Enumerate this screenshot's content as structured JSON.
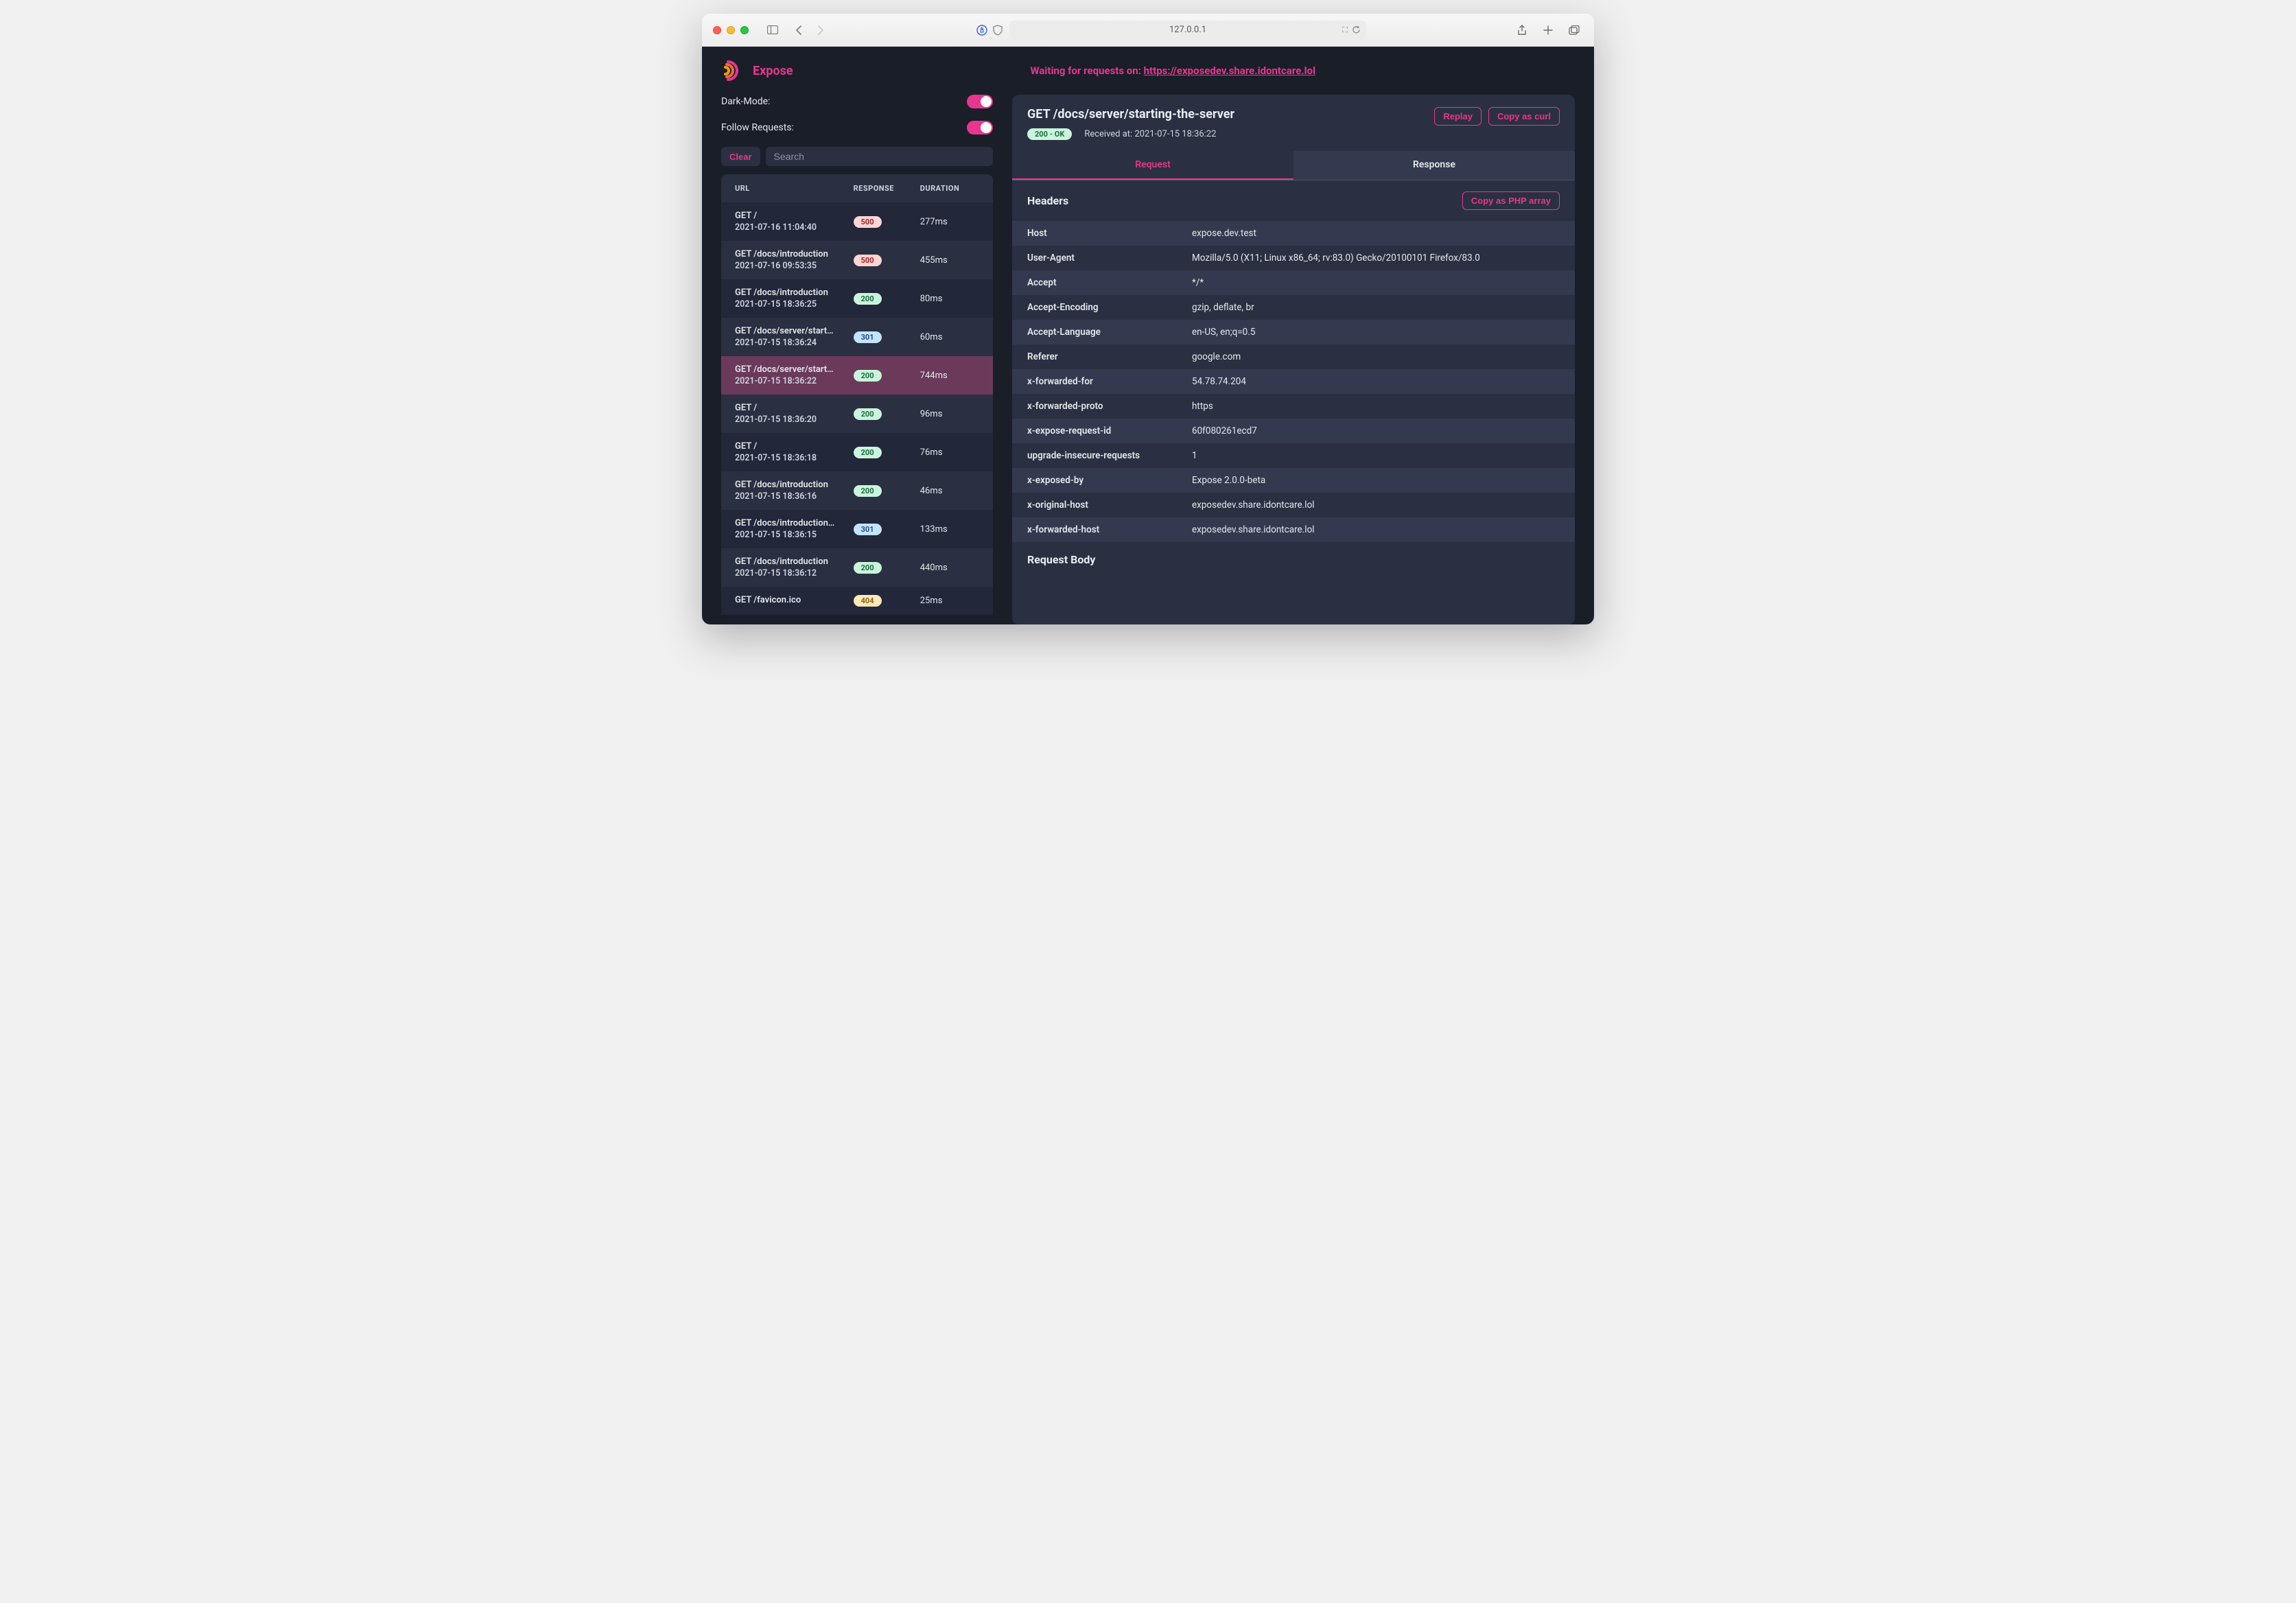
{
  "browser": {
    "address": "127.0.0.1"
  },
  "brand": {
    "name": "Expose"
  },
  "waitText": {
    "prefix": "Waiting for requests on: ",
    "url": "https://exposedev.share.idontcare.lol"
  },
  "sidebar": {
    "toggles": {
      "darkMode": "Dark-Mode:",
      "followRequests": "Follow Requests:"
    },
    "clearBtn": "Clear",
    "searchPlaceholder": "Search",
    "columns": {
      "url": "URL",
      "response": "RESPONSE",
      "duration": "DURATION"
    },
    "rows": [
      {
        "url": "GET /",
        "ts": "2021-07-16 11:04:40",
        "status": "500",
        "statusClass": "c500",
        "duration": "277ms"
      },
      {
        "url": "GET /docs/introduction",
        "ts": "2021-07-16 09:53:35",
        "status": "500",
        "statusClass": "c500",
        "duration": "455ms"
      },
      {
        "url": "GET /docs/introduction",
        "ts": "2021-07-15 18:36:25",
        "status": "200",
        "statusClass": "c200",
        "duration": "80ms"
      },
      {
        "url": "GET /docs/server/start…",
        "ts": "2021-07-15 18:36:24",
        "status": "301",
        "statusClass": "c301",
        "duration": "60ms"
      },
      {
        "url": "GET /docs/server/start…",
        "ts": "2021-07-15 18:36:22",
        "status": "200",
        "statusClass": "c200",
        "duration": "744ms",
        "selected": true
      },
      {
        "url": "GET /",
        "ts": "2021-07-15 18:36:20",
        "status": "200",
        "statusClass": "c200",
        "duration": "96ms"
      },
      {
        "url": "GET /",
        "ts": "2021-07-15 18:36:18",
        "status": "200",
        "statusClass": "c200",
        "duration": "76ms"
      },
      {
        "url": "GET /docs/introduction",
        "ts": "2021-07-15 18:36:16",
        "status": "200",
        "statusClass": "c200",
        "duration": "46ms"
      },
      {
        "url": "GET /docs/introduction…",
        "ts": "2021-07-15 18:36:15",
        "status": "301",
        "statusClass": "c301",
        "duration": "133ms"
      },
      {
        "url": "GET /docs/introduction",
        "ts": "2021-07-15 18:36:12",
        "status": "200",
        "statusClass": "c200",
        "duration": "440ms"
      },
      {
        "url": "GET /favicon.ico",
        "ts": "",
        "status": "404",
        "statusClass": "c404",
        "duration": "25ms"
      }
    ]
  },
  "detail": {
    "title": "GET /docs/server/starting-the-server",
    "statusBadge": "200 - OK",
    "receivedAt": "Received at: 2021-07-15 18:36:22",
    "btnReplay": "Replay",
    "btnCopyCurl": "Copy as curl",
    "tabs": {
      "request": "Request",
      "response": "Response"
    },
    "headersTitle": "Headers",
    "copyPhp": "Copy as PHP array",
    "headers": [
      {
        "k": "Host",
        "v": "expose.dev.test"
      },
      {
        "k": "User-Agent",
        "v": "Mozilla/5.0 (X11; Linux x86_64; rv:83.0) Gecko/20100101 Firefox/83.0"
      },
      {
        "k": "Accept",
        "v": "*/*"
      },
      {
        "k": "Accept-Encoding",
        "v": "gzip, deflate, br"
      },
      {
        "k": "Accept-Language",
        "v": "en-US, en;q=0.5"
      },
      {
        "k": "Referer",
        "v": "google.com"
      },
      {
        "k": "x-forwarded-for",
        "v": "54.78.74.204"
      },
      {
        "k": "x-forwarded-proto",
        "v": "https"
      },
      {
        "k": "x-expose-request-id",
        "v": "60f080261ecd7"
      },
      {
        "k": "upgrade-insecure-requests",
        "v": "1"
      },
      {
        "k": "x-exposed-by",
        "v": "Expose 2.0.0-beta"
      },
      {
        "k": "x-original-host",
        "v": "exposedev.share.idontcare.lol"
      },
      {
        "k": "x-forwarded-host",
        "v": "exposedev.share.idontcare.lol"
      }
    ],
    "bodyTitle": "Request Body"
  }
}
